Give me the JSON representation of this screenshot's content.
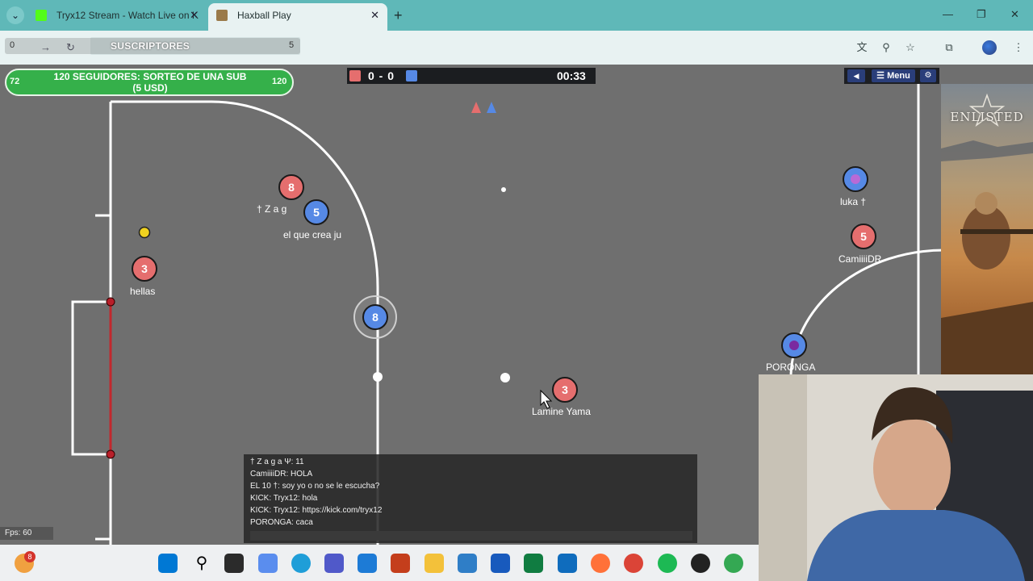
{
  "browser": {
    "tabs": [
      {
        "title": "Tryx12 Stream - Watch Live on K",
        "favicon_color": "#53fc18",
        "active": false
      },
      {
        "title": "Haxball Play",
        "favicon_color": "#9a7a4a",
        "active": true
      }
    ],
    "subscribers": {
      "left_value": "0",
      "label": "SUSCRIPTORES",
      "count": "5"
    }
  },
  "overlay": {
    "followers": {
      "current": "72",
      "label": "120 SEGUIDORES: SORTEO DE UNA SUB (5 USD)",
      "goal": "120",
      "progress": 0.6
    }
  },
  "game": {
    "score": "0 - 0",
    "timer": "00:33",
    "red_color": "#e56e6e",
    "blue_color": "#5689e5",
    "menu_label": "Menu",
    "fps": "Fps: 60",
    "players": [
      {
        "number": "8",
        "team": "red",
        "name": ""
      },
      {
        "number": "5",
        "team": "blue",
        "name": "† Z a g"
      },
      {
        "number": "",
        "team": "blue",
        "name": "el que crea ju"
      },
      {
        "number": "3",
        "team": "red",
        "name": "hellas"
      },
      {
        "number": "8",
        "team": "blue",
        "name": ""
      },
      {
        "number": "3",
        "team": "red",
        "name": "Lamine Yama"
      },
      {
        "number": "",
        "team": "blue",
        "name": "luka †"
      },
      {
        "number": "5",
        "team": "red",
        "name": "CamiiiiDR"
      },
      {
        "number": "",
        "team": "blue",
        "name": "PORONGA"
      }
    ],
    "chat": [
      "† Z a g a Ψ: 11",
      "CamiiiiDR: HOLA",
      "EL 10 †: soy yo o no se le escucha?",
      "KICK: Tryx12: hola",
      "KICK: Tryx12: https://kick.com/tryx12",
      "PORONGA: caca"
    ]
  },
  "poster": {
    "title": "ENLISTED"
  },
  "taskbar": {
    "badge": "8"
  }
}
